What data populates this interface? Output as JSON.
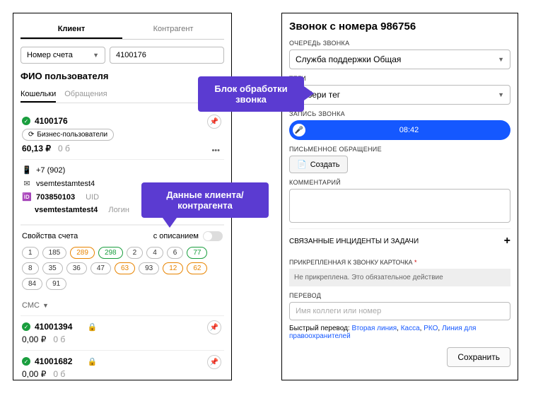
{
  "left": {
    "tabs": [
      "Клиент",
      "Контрагент"
    ],
    "account_type_label": "Номер счета",
    "account_value": "4100176",
    "user_label": "ФИО пользователя",
    "subtabs": [
      "Кошельки",
      "Обращения"
    ],
    "wallet": {
      "number": "4100176",
      "badge": "Бизнес-пользователи",
      "balance": "60,13 ₽",
      "balance2": "0 б"
    },
    "contact": {
      "phone": "+7 (902)",
      "email": "vsemtestamtest4",
      "uid_val": "703850103",
      "uid_label": "UID",
      "login_val": "vsemtestamtest4",
      "login_label": "Логин"
    },
    "props": {
      "title": "Свойства счета",
      "toggle_label": "с описанием",
      "chips": [
        {
          "t": "1"
        },
        {
          "t": "185"
        },
        {
          "t": "289",
          "c": "or"
        },
        {
          "t": "298",
          "c": "gr"
        },
        {
          "t": "2"
        },
        {
          "t": "4"
        },
        {
          "t": "6"
        },
        {
          "t": "77",
          "c": "gr"
        },
        {
          "t": "8"
        },
        {
          "t": "35"
        },
        {
          "t": "36"
        },
        {
          "t": "47"
        },
        {
          "t": "63",
          "c": "or"
        },
        {
          "t": "93"
        },
        {
          "t": "12",
          "c": "or"
        },
        {
          "t": "62",
          "c": "or"
        },
        {
          "t": "84"
        },
        {
          "t": "91"
        }
      ]
    },
    "smc": "СМС",
    "mini": [
      {
        "num": "41001394",
        "bal": "0,00 ₽",
        "bal2": "0 б"
      },
      {
        "num": "41001682",
        "bal": "0,00 ₽",
        "bal2": "0 б"
      }
    ]
  },
  "right": {
    "title": "Звонок с номера 986756",
    "queue_label": "ОЧЕРЕДЬ ЗВОНКА",
    "queue_value": "Служба поддержки Общая",
    "tags_label": "ТЕГИ",
    "tags_placeholder": "Выбери тег",
    "rec_label": "ЗАПИСЬ ЗВОНКА",
    "rec_time": "08:42",
    "written_label": "ПИСЬМЕННОЕ ОБРАЩЕНИЕ",
    "create_btn": "Создать",
    "comment_label": "КОММЕНТАРИЙ",
    "incidents_label": "СВЯЗАННЫЕ ИНЦИДЕНТЫ И ЗАДАЧИ",
    "card_label": "ПРИКРЕПЛЕННАЯ К ЗВОНКУ КАРТОЧКА",
    "card_text": "Не прикреплена. Это обязательное действие",
    "transfer_label": "ПЕРЕВОД",
    "transfer_placeholder": "Имя коллеги или номер",
    "quick_label": "Быстрый перевод:",
    "quick_links": [
      "Вторая линия",
      "Касса",
      "РКО",
      "Линия для правоохранителей"
    ],
    "save": "Сохранить"
  },
  "callouts": {
    "c1": "Блок обработки звонка",
    "c2": "Данные клиента/контрагента"
  }
}
